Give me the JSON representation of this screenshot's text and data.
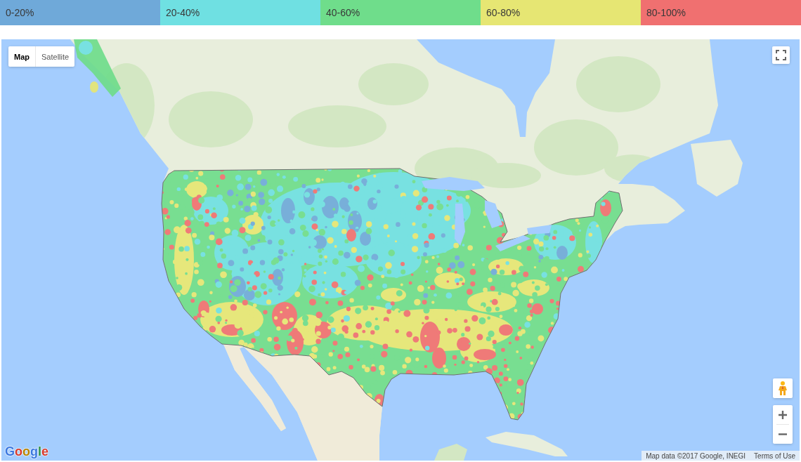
{
  "legend": [
    {
      "label": "0-20%",
      "color": "#6fa9d9"
    },
    {
      "label": "20-40%",
      "color": "#6fe0e2"
    },
    {
      "label": "40-60%",
      "color": "#6fdd8b"
    },
    {
      "label": "60-80%",
      "color": "#e6e673"
    },
    {
      "label": "80-100%",
      "color": "#f07070"
    }
  ],
  "map": {
    "map_type_control": [
      {
        "label": "Map",
        "selected": true
      },
      {
        "label": "Satellite",
        "selected": false
      }
    ],
    "logo": "Google",
    "attribution": {
      "text": "Map data ©2017 Google, INEGI",
      "link": "Terms of Use"
    }
  }
}
